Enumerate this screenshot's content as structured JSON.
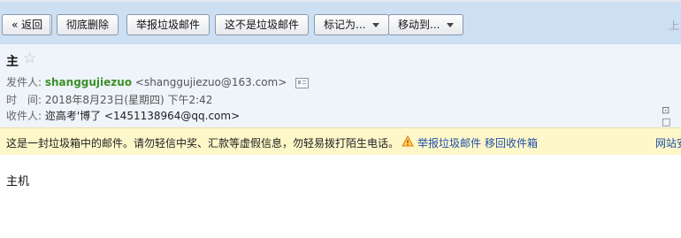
{
  "toolbar": {
    "back_label": "« 返回",
    "delete_forever_label": "彻底删除",
    "report_spam_label": "举报垃圾邮件",
    "not_spam_label": "这不是垃圾邮件",
    "mark_as_label": "标记为...",
    "move_to_label": "移动到...",
    "pager_label": "上"
  },
  "mail": {
    "subject": "主",
    "star_icon": "star-outline-icon",
    "sender_label": "发件人:",
    "sender_name": "shanggujiezuo",
    "sender_address": "<shanggujiezuo@163.com>",
    "time_label": "时　间:",
    "time_value": "2018年8月23日(星期四) 下午2:42",
    "recipient_label": "收件人:",
    "recipient_value": "迩高考'博了 <1451138964@qq.com>",
    "window_icons": "⊡ □"
  },
  "warning": {
    "text": "这是一封垃圾箱中的邮件。请勿轻信中奖、汇款等虚假信息，勿轻易拨打陌生电话。",
    "report_link": "举报垃圾邮件",
    "restore_link": "移回收件箱",
    "right_link": "网站安"
  },
  "body": {
    "content": "主机"
  },
  "colors": {
    "toolbar_bg": "#ccdff3",
    "header_bg": "#eef4fa",
    "warning_bg": "#fdf7c9",
    "sender_green": "#3c8f2a",
    "link_blue": "#1f4fa8"
  }
}
